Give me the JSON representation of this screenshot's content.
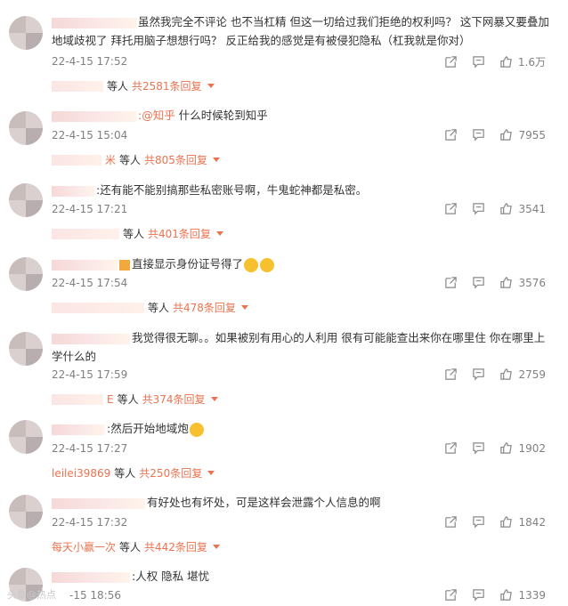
{
  "comments": [
    {
      "text": "虽然我完全不评论 也不当杠精 但这一切给过我们拒绝的权利吗？ 这下网暴又要叠加地域歧视了 拜托用脑子想想行吗？ 反正给我的感觉是有被侵犯隐私（杠我就是你对）",
      "time": "22-4-15 17:52",
      "likes": "1.6万",
      "reply_suffix": "等人",
      "reply_total": "共2581条回复"
    },
    {
      "mention": ":@知乎",
      "text": " 什么时候轮到知乎",
      "time": "22-4-15 15:04",
      "likes": "7955",
      "reply_name_tail": "米",
      "reply_suffix": "等人",
      "reply_total": "共805条回复"
    },
    {
      "text": ":还有能不能别搞那些私密账号啊，牛鬼蛇神都是私密。",
      "time": "22-4-15 17:21",
      "likes": "3541",
      "reply_suffix": "等人",
      "reply_total": "共401条回复"
    },
    {
      "text": "直接显示身份证号得了",
      "time": "22-4-15 17:54",
      "likes": "3576",
      "reply_suffix": "等人",
      "reply_total": "共478条回复"
    },
    {
      "text": "我觉得很无聊。。如果被别有用心的人利用 很有可能能查出来你在哪里住 你在哪里上学什么的",
      "time": "22-4-15 17:59",
      "likes": "2759",
      "reply_name_tail": "E",
      "reply_suffix": "等人",
      "reply_total": "共374条回复"
    },
    {
      "text": ":然后开始地域炮",
      "time": "22-4-15 17:27",
      "likes": "1902",
      "reply_name": "leilei39869",
      "reply_suffix": "等人",
      "reply_total": "共250条回复"
    },
    {
      "text": "有好处也有坏处，可是这样会泄露个人信息的啊",
      "time": "22-4-15 17:32",
      "likes": "1842",
      "reply_name": "每天小赢一次",
      "reply_suffix": "等人",
      "reply_total": "共442条回复"
    },
    {
      "text": ":人权 隐私 堪忧",
      "time": "-15 18:56",
      "likes": "1339"
    }
  ],
  "watermark": "头条@热点",
  "colors": {
    "accent": "#eb7350",
    "muted": "#808080"
  },
  "icons": [
    "share-icon",
    "comment-icon",
    "like-icon"
  ]
}
